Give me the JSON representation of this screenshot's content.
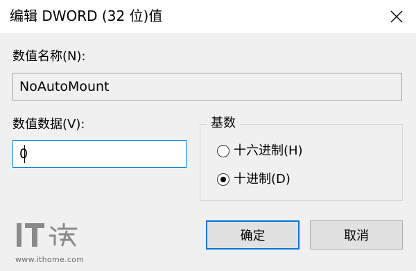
{
  "window": {
    "title": "编辑 DWORD (32 位)值"
  },
  "form": {
    "name_label": "数值名称(N):",
    "name_value": "NoAutoMount",
    "data_label": "数值数据(V):",
    "data_value": "0"
  },
  "base": {
    "legend": "基数",
    "options": [
      {
        "label": "十六进制(H)",
        "selected": false
      },
      {
        "label": "十进制(D)",
        "selected": true
      }
    ]
  },
  "buttons": {
    "ok": "确定",
    "cancel": "取消"
  },
  "watermark": {
    "logo": "IT之家",
    "url": "www.ithome.com"
  },
  "colors": {
    "accent": "#0078d7",
    "background": "#f0f0f0"
  }
}
